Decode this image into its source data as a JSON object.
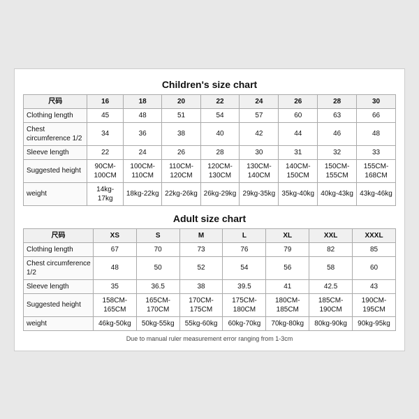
{
  "children_chart": {
    "title": "Children's size chart",
    "columns": [
      "尺码",
      "16",
      "18",
      "20",
      "22",
      "24",
      "26",
      "28",
      "30"
    ],
    "rows": [
      {
        "label": "Clothing length",
        "values": [
          "45",
          "48",
          "51",
          "54",
          "57",
          "60",
          "63",
          "66"
        ]
      },
      {
        "label": "Chest circumference 1/2",
        "values": [
          "34",
          "36",
          "38",
          "40",
          "42",
          "44",
          "46",
          "48"
        ]
      },
      {
        "label": "Sleeve length",
        "values": [
          "22",
          "24",
          "26",
          "28",
          "30",
          "31",
          "32",
          "33"
        ]
      },
      {
        "label": "Suggested height",
        "values": [
          "90CM-100CM",
          "100CM-110CM",
          "110CM-120CM",
          "120CM-130CM",
          "130CM-140CM",
          "140CM-150CM",
          "150CM-155CM",
          "155CM-168CM"
        ]
      },
      {
        "label": "weight",
        "values": [
          "14kg-17kg",
          "18kg-22kg",
          "22kg-26kg",
          "26kg-29kg",
          "29kg-35kg",
          "35kg-40kg",
          "40kg-43kg",
          "43kg-46kg"
        ]
      }
    ]
  },
  "adult_chart": {
    "title": "Adult size chart",
    "columns": [
      "尺码",
      "XS",
      "S",
      "M",
      "L",
      "XL",
      "XXL",
      "XXXL"
    ],
    "rows": [
      {
        "label": "Clothing length",
        "values": [
          "67",
          "70",
          "73",
          "76",
          "79",
          "82",
          "85"
        ]
      },
      {
        "label": "Chest circumference 1/2",
        "values": [
          "48",
          "50",
          "52",
          "54",
          "56",
          "58",
          "60"
        ]
      },
      {
        "label": "Sleeve length",
        "values": [
          "35",
          "36.5",
          "38",
          "39.5",
          "41",
          "42.5",
          "43"
        ]
      },
      {
        "label": "Suggested height",
        "values": [
          "158CM-165CM",
          "165CM-170CM",
          "170CM-175CM",
          "175CM-180CM",
          "180CM-185CM",
          "185CM-190CM",
          "190CM-195CM"
        ]
      },
      {
        "label": "weight",
        "values": [
          "46kg-50kg",
          "50kg-55kg",
          "55kg-60kg",
          "60kg-70kg",
          "70kg-80kg",
          "80kg-90kg",
          "90kg-95kg"
        ]
      }
    ]
  },
  "disclaimer": "Due to manual ruler measurement error ranging from 1-3cm"
}
